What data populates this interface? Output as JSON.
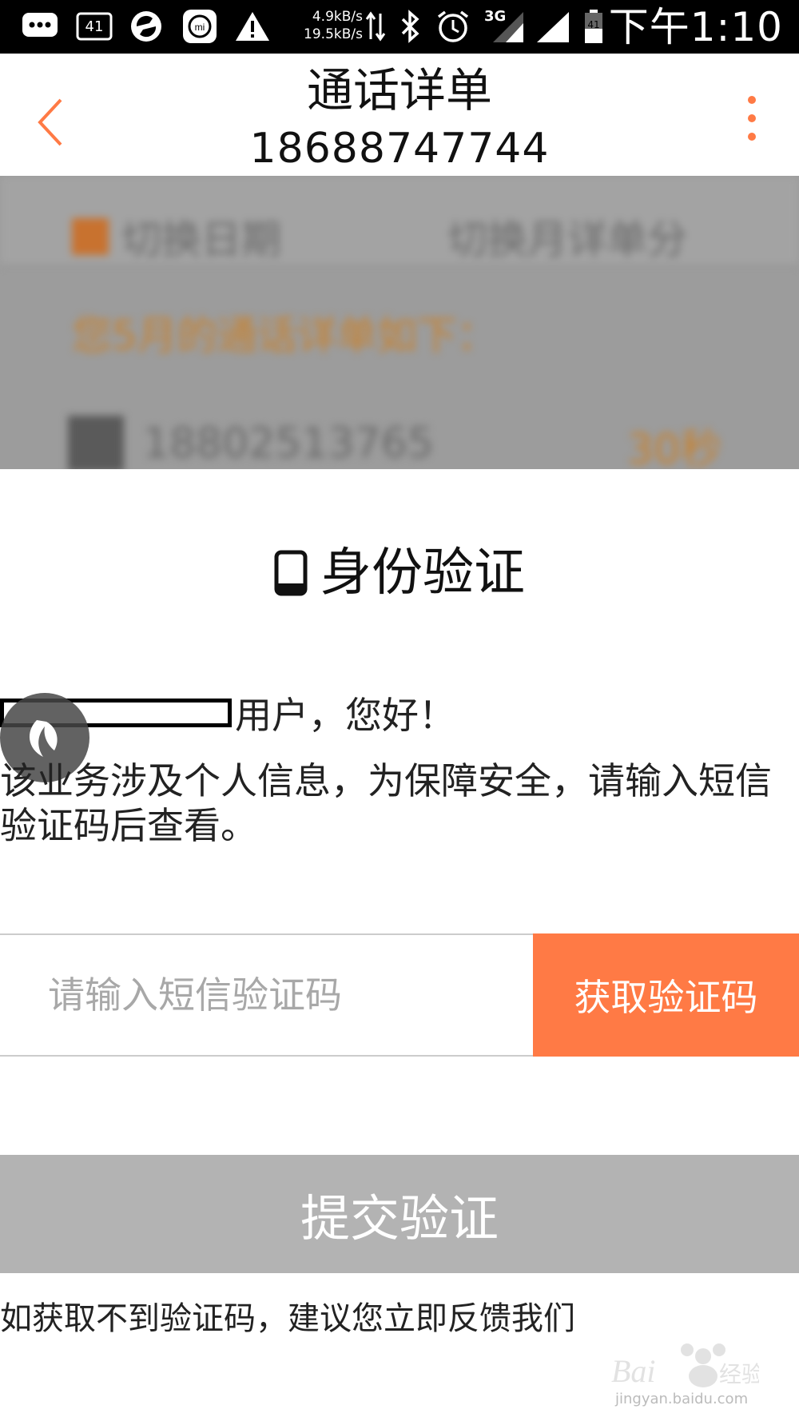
{
  "status_bar": {
    "notif_count": "41",
    "net_up": "4.9kB/s",
    "net_down": "19.5kB/s",
    "network_type": "3G",
    "battery_level": "41",
    "time": "下午1:10"
  },
  "header": {
    "title": "通话详单",
    "phone": "18688747744"
  },
  "background": {
    "switch_date": "切换日期",
    "switch_month": "切换月详单分",
    "hint": "您5月的通话详单如下：",
    "call_number": "18802513765",
    "call_duration": "30秒"
  },
  "verify": {
    "title": "身份验证",
    "greeting": "用户，您好！",
    "description": "该业务涉及个人信息，为保障安全，请输入短信\n验证码后查看。",
    "code_placeholder": "请输入短信验证码",
    "get_code_label": "获取验证码",
    "submit_label": "提交验证",
    "feedback": "如获取不到验证码，建议您立即反馈我们"
  },
  "watermark": {
    "url": "jingyan.baidu.com"
  },
  "colors": {
    "accent": "#ff7a45",
    "submit_disabled": "#b3b3b3"
  }
}
